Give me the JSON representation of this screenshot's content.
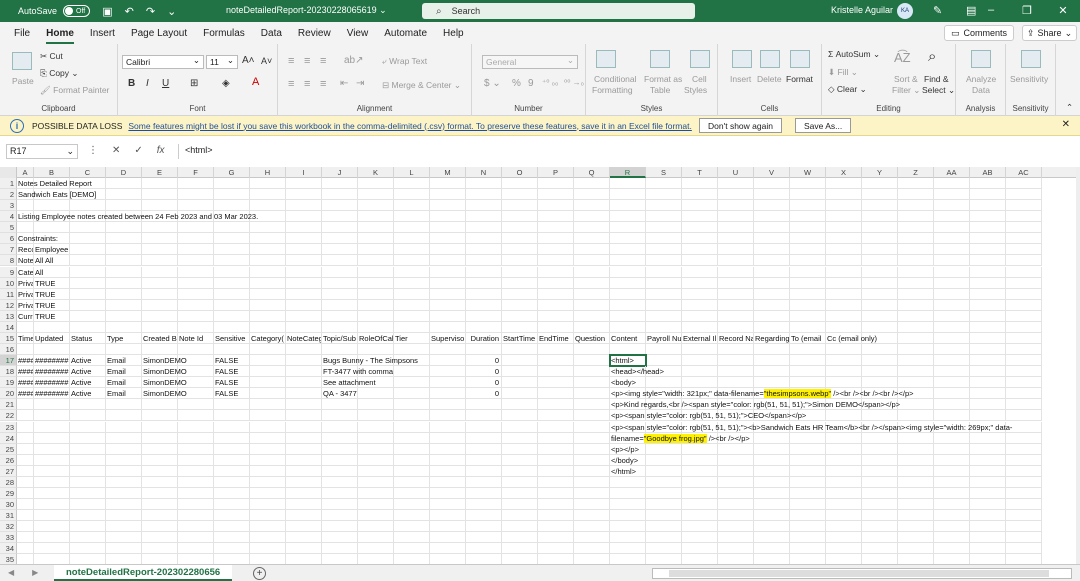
{
  "titlebar": {
    "autosave_label": "AutoSave",
    "autosave_state": "Off",
    "doc_title": "noteDetailedReport-20230228065619 ⌄",
    "search_placeholder": "Search",
    "user_name": "Kristelle Aguilar",
    "user_initials": "KA"
  },
  "menu": {
    "tabs": [
      "File",
      "Home",
      "Insert",
      "Page Layout",
      "Formulas",
      "Data",
      "Review",
      "View",
      "Automate",
      "Help"
    ],
    "active": "Home",
    "comments_label": "Comments",
    "share_label": "Share"
  },
  "ribbon": {
    "clipboard": {
      "label": "Clipboard",
      "paste": "Paste",
      "cut": "Cut",
      "copy": "Copy",
      "format_painter": "Format Painter"
    },
    "font": {
      "label": "Font",
      "name": "Calibri",
      "size": "11"
    },
    "alignment": {
      "label": "Alignment",
      "wrap_text": "Wrap Text",
      "merge_center": "Merge & Center"
    },
    "number": {
      "label": "Number",
      "format": "General"
    },
    "styles": {
      "label": "Styles",
      "conditional": "Conditional",
      "formatting": "Formatting",
      "format_as": "Format as",
      "table": "Table",
      "cell": "Cell",
      "styles": "Styles"
    },
    "cells": {
      "label": "Cells",
      "insert": "Insert",
      "delete": "Delete",
      "format": "Format"
    },
    "editing": {
      "label": "Editing",
      "autosum": "AutoSum",
      "fill": "Fill",
      "clear": "Clear",
      "sort_filter": "Sort &",
      "filter": "Filter",
      "find_select": "Find &",
      "select": "Select"
    },
    "analysis": {
      "label": "Analysis",
      "analyze": "Analyze",
      "data": "Data"
    },
    "sensitivity": {
      "label": "Sensitivity",
      "sensitivity": "Sensitivity"
    }
  },
  "infobar": {
    "title": "POSSIBLE DATA LOSS",
    "message": "Some features might be lost if you save this workbook in the comma-delimited (.csv) format. To preserve these features, save it in an Excel file format.",
    "dont_show": "Don't show again",
    "save_as": "Save As..."
  },
  "formula_bar": {
    "name_box": "R17",
    "content": "<html>"
  },
  "columns": [
    "A",
    "B",
    "C",
    "D",
    "E",
    "F",
    "G",
    "H",
    "I",
    "J",
    "K",
    "L",
    "M",
    "N",
    "O",
    "P",
    "Q",
    "R",
    "S",
    "T",
    "U",
    "V",
    "W",
    "X",
    "Y",
    "Z",
    "AA",
    "AB",
    "AC"
  ],
  "selected_column": "R",
  "selected_row": 17,
  "rows": [
    {
      "n": 1,
      "cells": {
        "A": "Notes Detailed Report"
      }
    },
    {
      "n": 2,
      "cells": {
        "A": "Sandwich Eats [DEMO]"
      }
    },
    {
      "n": 3,
      "cells": {}
    },
    {
      "n": 4,
      "cells": {
        "A": "Listing Employee notes created between 24 Feb 2023 and 03 Mar 2023."
      }
    },
    {
      "n": 5,
      "cells": {}
    },
    {
      "n": 6,
      "cells": {
        "A": "Constraints:"
      }
    },
    {
      "n": 7,
      "cells": {
        "A": "Record Ty",
        "B": "Employee"
      }
    },
    {
      "n": 8,
      "cells": {
        "A": "Note Type",
        "B": "All All"
      }
    },
    {
      "n": 9,
      "cells": {
        "A": "Category (",
        "B": "All"
      }
    },
    {
      "n": 10,
      "cells": {
        "A": "Privacy: Sl",
        "B": "TRUE"
      }
    },
    {
      "n": 11,
      "cells": {
        "A": "Privacy: Sl",
        "B": "TRUE"
      }
    },
    {
      "n": 12,
      "cells": {
        "A": "Privacy: Sl",
        "B": "TRUE"
      }
    },
    {
      "n": 13,
      "cells": {
        "A": "Current V",
        "B": "TRUE"
      }
    },
    {
      "n": 14,
      "cells": {}
    },
    {
      "n": 15,
      "cells": {
        "A": "Timestam",
        "B": "Updated",
        "C": "Status",
        "D": "Type",
        "E": "Created B",
        "F": "Note Id",
        "G": "Sensitive",
        "H": "Category(",
        "I": "NoteCateg",
        "J": "Topic/Sub",
        "K": "RoleOfCal",
        "L": "Tier",
        "M": "Superviso",
        "N": "Duration",
        "O": "StartTime",
        "P": "EndTime",
        "Q": "Question",
        "R": "Content",
        "S": "Payroll Nu",
        "T": "External Il",
        "U": "Record Na",
        "V": "Regarding",
        "W": "To (email",
        "X": "Cc (email only)"
      }
    },
    {
      "n": 16,
      "cells": {}
    },
    {
      "n": 17,
      "cells": {
        "A": "########",
        "B": "########",
        "C": "Active",
        "D": "Email",
        "E": "SimonDEMO",
        "G": "FALSE",
        "J": "Bugs Bunny - The Simpsons",
        "N": "0",
        "R": "<html>"
      }
    },
    {
      "n": 18,
      "cells": {
        "A": "########",
        "B": "########",
        "C": "Active",
        "D": "Email",
        "E": "SimonDEMO",
        "G": "FALSE",
        "J": "FT-3477 with comma",
        "N": "0",
        "R": "<head></head>"
      }
    },
    {
      "n": 19,
      "cells": {
        "A": "########",
        "B": "########",
        "C": "Active",
        "D": "Email",
        "E": "SimonDEMO",
        "G": "FALSE",
        "J": "See attachment",
        "N": "0",
        "R": "<body>"
      }
    },
    {
      "n": 20,
      "cells": {
        "A": "########",
        "B": "########",
        "C": "Active",
        "D": "Email",
        "E": "SimonDEMO",
        "G": "FALSE",
        "J": "QA - 3477",
        "N": "0",
        "R_pre": "<p><img style=\"width: 321px;\" data-filename=",
        "R_hl": "\"thesimpsons.webp\"",
        "R_post": " /><br /><br /><br /></p>"
      }
    },
    {
      "n": 21,
      "cells": {
        "R": "<p>Kind regards,<br /><span style=\"color: rgb(51, 51, 51);\">Simon DEMO</span></p>"
      }
    },
    {
      "n": 22,
      "cells": {
        "R": "<p><span style=\"color: rgb(51, 51, 51);\">CEO</span></p>"
      }
    },
    {
      "n": 23,
      "cells": {
        "R": "<p><span style=\"color: rgb(51, 51, 51);\"><b>Sandwich Eats HR Team</b><br /></span><img style=\"width: 269px;\" data-"
      }
    },
    {
      "n": 24,
      "cells": {
        "R_pre": "filename=",
        "R_hl": "\"Goodbye frog.jpg\"",
        "R_post": " /><br /></p>"
      }
    },
    {
      "n": 25,
      "cells": {
        "R": "<p></p>"
      }
    },
    {
      "n": 26,
      "cells": {
        "R": "</body>"
      }
    },
    {
      "n": 27,
      "cells": {
        "R": "</html>"
      }
    },
    {
      "n": 28,
      "cells": {}
    },
    {
      "n": 29,
      "cells": {}
    },
    {
      "n": 30,
      "cells": {}
    },
    {
      "n": 31,
      "cells": {}
    },
    {
      "n": 32,
      "cells": {}
    },
    {
      "n": 33,
      "cells": {}
    },
    {
      "n": 34,
      "cells": {}
    },
    {
      "n": 35,
      "cells": {}
    }
  ],
  "sheet_tab": "noteDetailedReport-202302280656",
  "colors": {
    "excel_green": "#217346",
    "highlight": "#fff200",
    "infobar": "#fcf4c6"
  }
}
